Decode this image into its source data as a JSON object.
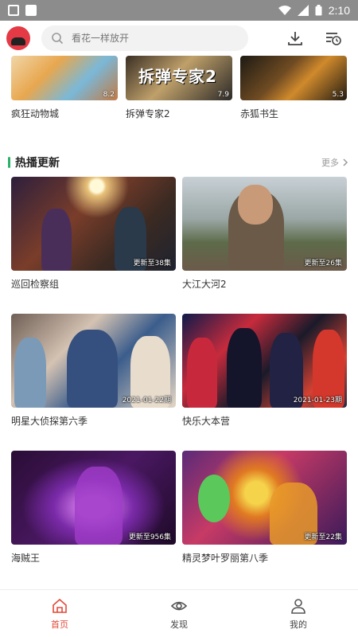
{
  "status_bar": {
    "time": "2:10"
  },
  "header": {
    "logo_icon": "app-logo-icon",
    "search": {
      "placeholder": "看花一样放开"
    },
    "icons": [
      "download-icon",
      "history-icon"
    ]
  },
  "top_row": [
    {
      "title": "疯狂动物城",
      "badge": "8.2"
    },
    {
      "title": "拆弹专家2",
      "badge": "7.9",
      "poster_text": "拆弹专家2"
    },
    {
      "title": "赤狐书生",
      "badge": "5.3"
    }
  ],
  "section": {
    "title": "热播更新",
    "more": "更多"
  },
  "grid": [
    {
      "title": "巡回检察组",
      "badge": "更新至38集"
    },
    {
      "title": "大江大河2",
      "badge": "更新至26集"
    },
    {
      "title": "明星大侦探第六季",
      "badge": "2021-01-22期"
    },
    {
      "title": "快乐大本营",
      "badge": "2021-01-23期"
    },
    {
      "title": "海贼王",
      "badge": "更新至956集"
    },
    {
      "title": "精灵梦叶罗丽第八季",
      "badge": "更新至22集"
    }
  ],
  "bottom_nav": [
    {
      "label": "首页",
      "icon": "home-icon",
      "active": true
    },
    {
      "label": "发现",
      "icon": "eye-icon",
      "active": false
    },
    {
      "label": "我的",
      "icon": "user-icon",
      "active": false
    }
  ],
  "colors": {
    "accent": "#e24a3a",
    "section_bar": "#2ab26a",
    "status_bar": "#8c8c8c"
  }
}
